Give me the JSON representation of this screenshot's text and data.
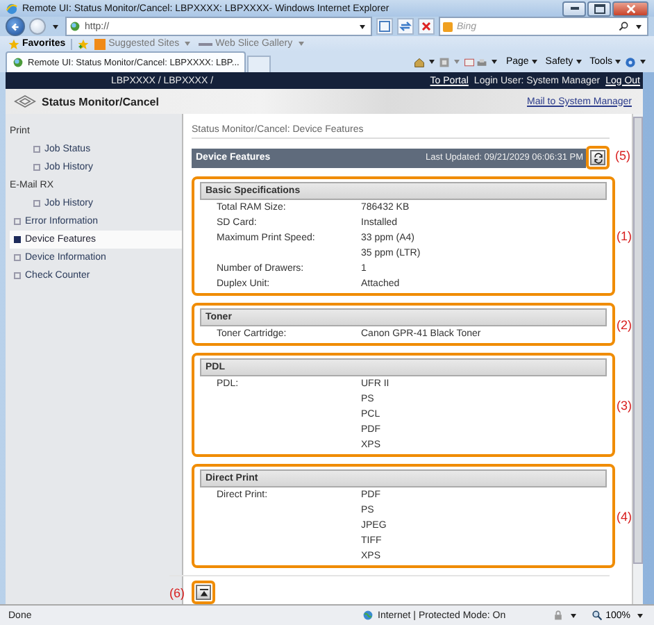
{
  "window": {
    "title": "Remote UI: Status Monitor/Cancel: LBPXXXX: LBPXXXX- Windows Internet Explorer"
  },
  "address_bar": {
    "value": "http://"
  },
  "search": {
    "placeholder": "Bing"
  },
  "favorites_bar": {
    "favorites": "Favorites",
    "links": [
      "Suggested Sites",
      "Web Slice Gallery"
    ]
  },
  "tab": {
    "title": "Remote UI: Status Monitor/Cancel: LBPXXXX: LBP..."
  },
  "command_bar": [
    "Page",
    "Safety",
    "Tools"
  ],
  "page": {
    "device_path": "LBPXXXX / LBPXXXX /",
    "to_portal": "To Portal",
    "login_user": "Login User: System Manager",
    "log_out": "Log Out",
    "heading": "Status Monitor/Cancel",
    "mail_link": "Mail to System Manager"
  },
  "sidebar": {
    "items": [
      {
        "label": "Print",
        "selected": false,
        "children": [
          {
            "label": "Job Status",
            "selected": false
          },
          {
            "label": "Job History",
            "selected": false
          }
        ]
      },
      {
        "label": "E-Mail RX",
        "selected": false,
        "children": [
          {
            "label": "Job History",
            "selected": false
          }
        ]
      },
      {
        "label": "Error Information",
        "selected": false
      },
      {
        "label": "Device Features",
        "selected": true
      },
      {
        "label": "Device Information",
        "selected": false
      },
      {
        "label": "Check Counter",
        "selected": false
      }
    ]
  },
  "breadcrumb": "Status Monitor/Cancel: Device Features",
  "panel": {
    "title": "Device Features",
    "last_updated": "Last Updated: 09/21/2029 06:06:31 PM",
    "refresh_callout": "(5)"
  },
  "sections": [
    {
      "title": "Basic Specifications",
      "callout": "(1)",
      "rows": [
        {
          "label": "Total RAM Size:",
          "values": [
            "786432 KB"
          ]
        },
        {
          "label": "SD Card:",
          "values": [
            "Installed"
          ]
        },
        {
          "label": "Maximum Print Speed:",
          "values": [
            "33 ppm (A4)",
            "35 ppm (LTR)"
          ]
        },
        {
          "label": "Number of Drawers:",
          "values": [
            "1"
          ]
        },
        {
          "label": "Duplex Unit:",
          "values": [
            "Attached"
          ]
        }
      ]
    },
    {
      "title": "Toner",
      "callout": "(2)",
      "rows": [
        {
          "label": "Toner Cartridge:",
          "values": [
            "Canon GPR-41 Black Toner"
          ]
        }
      ]
    },
    {
      "title": "PDL",
      "callout": "(3)",
      "rows": [
        {
          "label": "PDL:",
          "values": [
            "UFR II",
            "PS",
            "PCL",
            "PDF",
            "XPS"
          ]
        }
      ]
    },
    {
      "title": "Direct Print",
      "callout": "(4)",
      "rows": [
        {
          "label": "Direct Print:",
          "values": [
            "PDF",
            "PS",
            "JPEG",
            "TIFF",
            "XPS"
          ]
        }
      ]
    }
  ],
  "top_callout": "(6)",
  "status_bar": {
    "text": "Done",
    "zone": "Internet | Protected Mode: On",
    "zoom": "100%"
  }
}
